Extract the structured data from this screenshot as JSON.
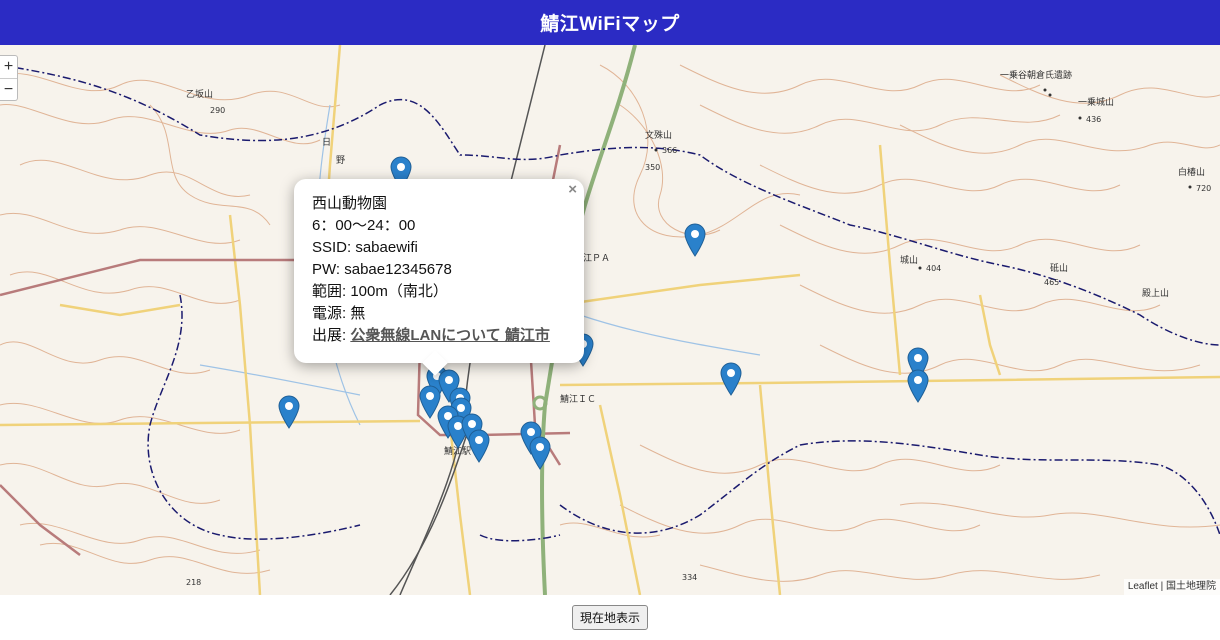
{
  "header": {
    "title": "鯖江WiFiマップ"
  },
  "map": {
    "zoom_in_label": "+",
    "zoom_out_label": "−",
    "labels": {
      "otosakayama": "乙坂山",
      "h290": "290",
      "monjusan": "文殊山",
      "h366": "366",
      "h350": "350",
      "ichijodani": "一乗谷朝倉氏遺跡",
      "ichijokiyama": "一乗城山",
      "h436": "436",
      "shiratsubakiyama": "白椿山",
      "h720": "720",
      "pa": "江ＰＡ",
      "shiroyama": "城山",
      "h404": "404",
      "toishiyama": "砥山",
      "h465": "465",
      "tonoueyama": "殿上山",
      "sabae_ic": "鯖江ＩＣ",
      "sabae_station": "鯖江駅",
      "h218": "218",
      "h334": "334",
      "hino": "日",
      "hino2": "野"
    },
    "attribution": {
      "leaflet": "Leaflet",
      "separator": " | ",
      "gsi": "国土地理院"
    }
  },
  "popup": {
    "close": "×",
    "name": "西山動物園",
    "hours": "6：00〜24：00",
    "ssid": "SSID: sabaewifi",
    "password": "PW: sabae12345678",
    "range": "範囲: 100m（南北）",
    "power": "電源: 無",
    "source_prefix": "出展: ",
    "source_link": "公衆無線LANについて 鯖江市"
  },
  "footer": {
    "locate_button": "現在地表示"
  },
  "colors": {
    "header_bg": "#2b2bc4",
    "marker": "#2a81cb",
    "contour": "#d9a07a",
    "road": "#f0d27a",
    "boundary": "#1a1a6e"
  }
}
